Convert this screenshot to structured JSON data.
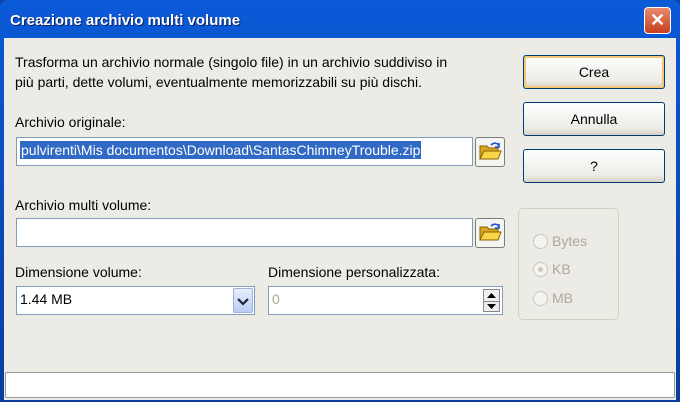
{
  "window": {
    "title": "Creazione archivio multi volume"
  },
  "description": "Trasforma un archivio normale (singolo file) in un archivio suddiviso in più parti, dette volumi, eventualmente memorizzabili su più dischi.",
  "description_lines": [
    "Trasforma un archivio normale (singolo file) in un archivio suddiviso in",
    "più parti, dette volumi, eventualmente memorizzabili su più dischi."
  ],
  "original": {
    "label": "Archivio originale:",
    "value": "pulvirenti\\Mis documentos\\Download\\SantasChimneyTrouble.zip"
  },
  "multi": {
    "label": "Archivio multi volume:",
    "value": ""
  },
  "volume_size": {
    "label": "Dimensione volume:",
    "value": "1.44 MB"
  },
  "custom_size": {
    "label": "Dimensione personalizzata:",
    "value": "0"
  },
  "units": {
    "options": [
      "Bytes",
      "KB",
      "MB"
    ],
    "selected": "KB"
  },
  "buttons": {
    "create": "Crea",
    "cancel": "Annulla",
    "help": "?"
  }
}
